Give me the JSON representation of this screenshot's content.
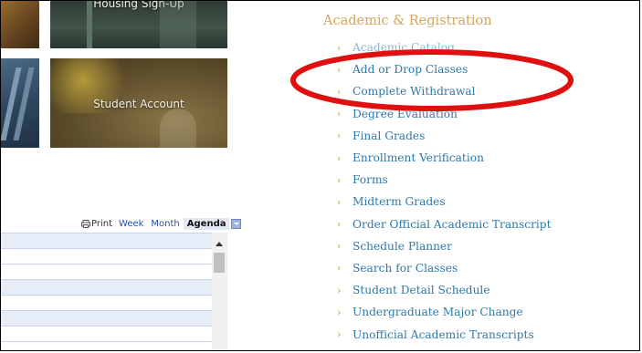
{
  "tiles": {
    "housing_label": "Housing Sign-Up",
    "student_account_label": "Student Account"
  },
  "calendar": {
    "print_label": "Print",
    "tabs": [
      {
        "label": "Week"
      },
      {
        "label": "Month"
      },
      {
        "label": "Agenda"
      }
    ],
    "active_tab": "Agenda"
  },
  "academic": {
    "title": "Academic & Registration",
    "items": [
      {
        "label": "Academic Catalog"
      },
      {
        "label": "Add or Drop Classes"
      },
      {
        "label": "Complete Withdrawal"
      },
      {
        "label": "Degree Evaluation"
      },
      {
        "label": "Final Grades"
      },
      {
        "label": "Enrollment Verification"
      },
      {
        "label": "Forms"
      },
      {
        "label": "Midterm Grades"
      },
      {
        "label": "Order Official Academic Transcript"
      },
      {
        "label": "Schedule Planner"
      },
      {
        "label": "Search for Classes"
      },
      {
        "label": "Student Detail Schedule"
      },
      {
        "label": "Undergraduate Major Change"
      },
      {
        "label": "Unofficial Academic Transcripts"
      }
    ]
  },
  "colors": {
    "section_title": "#d3a55c",
    "link": "#2f78a6",
    "chevron": "#c99a4d",
    "annotation_ellipse": "#e01010"
  },
  "icons": [
    "chevron-right-icon",
    "print-icon",
    "dropdown-arrow-icon",
    "scroll-up-icon"
  ]
}
